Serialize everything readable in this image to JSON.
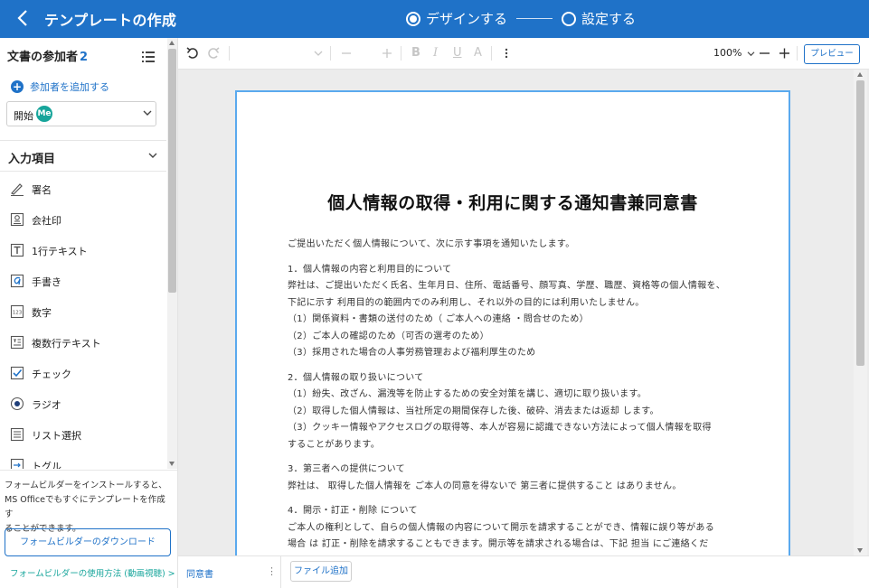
{
  "header": {
    "title": "テンプレートの作成",
    "steps": [
      {
        "label": "デザインする",
        "active": true
      },
      {
        "label": "設定する",
        "active": false
      }
    ]
  },
  "sidebar": {
    "participants_title": "文書の参加者",
    "participants_count": "2",
    "add_participant": "参加者を追加する",
    "participant_select": {
      "label": "開始",
      "badge": "Me"
    },
    "fields_title": "入力項目",
    "fields": [
      {
        "label": "署名",
        "icon": "signature-icon"
      },
      {
        "label": "会社印",
        "icon": "company-seal-icon"
      },
      {
        "label": "1行テキスト",
        "icon": "text-icon"
      },
      {
        "label": "手書き",
        "icon": "handwriting-icon"
      },
      {
        "label": "数字",
        "icon": "number-icon"
      },
      {
        "label": "複数行テキスト",
        "icon": "multiline-text-icon"
      },
      {
        "label": "チェック",
        "icon": "checkbox-icon"
      },
      {
        "label": "ラジオ",
        "icon": "radio-icon"
      },
      {
        "label": "リスト選択",
        "icon": "list-select-icon"
      },
      {
        "label": "トグル",
        "icon": "toggle-icon"
      }
    ],
    "footer_info": [
      "フォームビルダーをインストールすると、",
      "MS Officeでもすぐにテンプレートを作成す",
      "ることができます。"
    ],
    "download_button": "フォームビルダーのダウンロード",
    "howto_link": "フォームビルダーの使用方法 (動画視聴) >"
  },
  "toolbar": {
    "zoom": "100%",
    "preview": "プレビュー",
    "format_buttons": [
      "B",
      "I",
      "U",
      "A"
    ]
  },
  "document": {
    "title": "個人情報の取得・利用に関する通知書兼同意書",
    "paragraphs": [
      [
        "ご提出いただく個人情報について、次に示す事項を通知いたします。"
      ],
      [
        "1．個人情報の内容と利用目的について",
        "弊社は、ご提出いただく氏名、生年月日、住所、電話番号、顔写真、学歴、職歴、資格等の個人情報を、",
        "下記に示す 利用目的の範囲内でのみ利用し、それ以外の目的には利用いたしません。",
        "（1）関係資料・書類の送付のため（ ご本人への連絡 ・問合せのため）",
        "（2）ご本人の確認のため（可否の選考のため）",
        "（3）採用された場合の人事労務管理および福利厚生のため"
      ],
      [
        "2．個人情報の取り扱いについて",
        "（1）紛失、改ざん、漏洩等を防止するための安全対策を講じ、適切に取り扱います。",
        "（2）取得した個人情報は、当社所定の期間保存した後、破砕、消去または返却 します。",
        "（3）クッキー情報やアクセスログの取得等、本人が容易に認識できない方法によって個人情報を取得",
        "することがあります。"
      ],
      [
        "3．第三者への提供について",
        "弊社は、 取得した個人情報を ご本人の同意を得ないで 第三者に提供すること はありません。"
      ],
      [
        "4．開示・訂正・削除 について",
        "ご本人の権利として、自らの個人情報の内容について開示を請求することができ、情報に誤り等がある",
        "場合 は 訂正・削除を請求することもできます。開示等を請求される場合は、下記 担当 にご連絡くだ"
      ]
    ]
  },
  "bottom": {
    "doc_tab": "同意書",
    "add_file": "ファイル追加"
  },
  "colors": {
    "primary": "#1f72c8",
    "accent_teal": "#17a59b",
    "page_border": "#5aa9ee"
  }
}
